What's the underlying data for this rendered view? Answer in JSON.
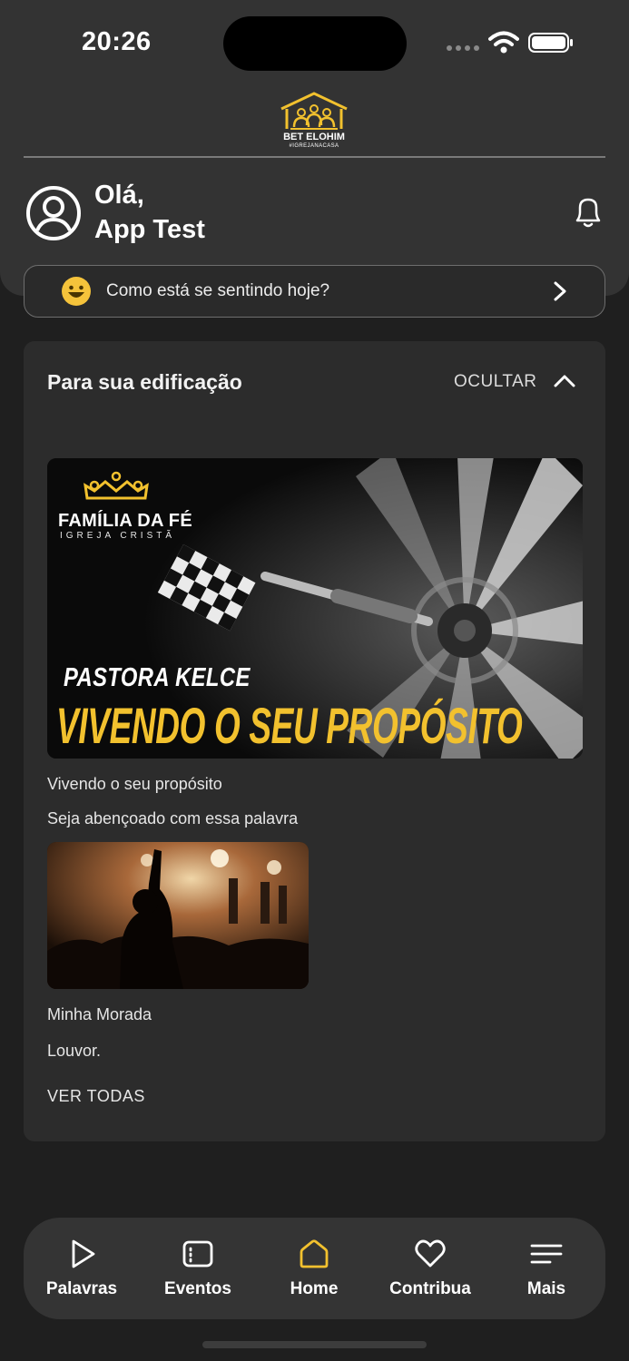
{
  "status_bar": {
    "time": "20:26"
  },
  "brand": {
    "name": "BET ELOHIM",
    "tagline": "#IGREJANACASA",
    "accent": "#F2C12E"
  },
  "greeting": {
    "hello": "Olá,",
    "user": "App Test"
  },
  "mood": {
    "prompt": "Como está se sentindo hoje?",
    "emoji": "😀"
  },
  "section": {
    "title": "Para sua edificação",
    "hide_label": "OCULTAR",
    "see_all": "VER TODAS",
    "items": [
      {
        "title": "Vivendo o seu propósito",
        "subtitle": "Seja abençoado com essa palavra",
        "banner_brand": "FAMÍLIA DA FÉ",
        "banner_brand_sub": "IGREJA CRISTÃ",
        "banner_speaker": "PASTORA KELCE",
        "banner_title": "VIVENDO O SEU PROPÓSITO"
      },
      {
        "title": "Minha Morada",
        "subtitle": "Louvor."
      }
    ]
  },
  "nav": [
    {
      "label": "Palavras",
      "icon": "play-icon"
    },
    {
      "label": "Eventos",
      "icon": "calendar-icon"
    },
    {
      "label": "Home",
      "icon": "home-icon",
      "active": true
    },
    {
      "label": "Contribua",
      "icon": "heart-icon"
    },
    {
      "label": "Mais",
      "icon": "menu-icon"
    }
  ],
  "colors": {
    "active_nav": "#F2C12E",
    "background": "#1F1F1F",
    "card": "#2C2C2C"
  }
}
